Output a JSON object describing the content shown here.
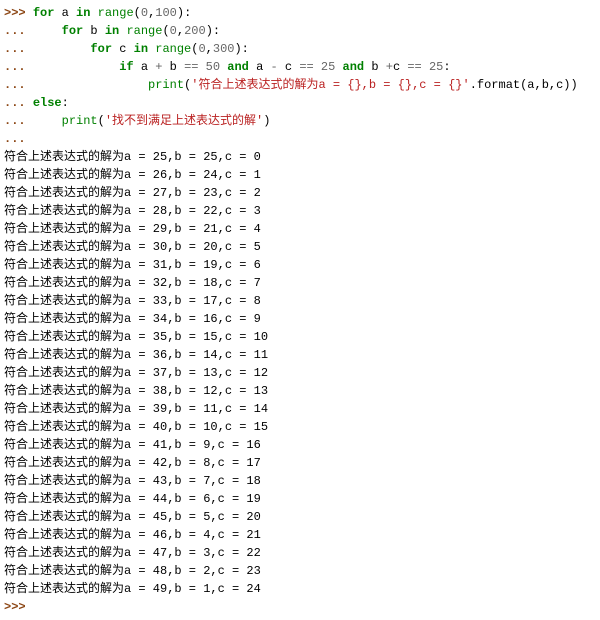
{
  "code": {
    "prompt_primary": ">>>",
    "prompt_cont": "...",
    "kw_for": "for",
    "kw_in": "in",
    "kw_if": "if",
    "kw_and": "and",
    "kw_else": "else",
    "builtin_range": "range",
    "builtin_print": "print",
    "var_a": "a",
    "var_b": "b",
    "var_c": "c",
    "num_0": "0",
    "num_100": "100",
    "num_200": "200",
    "num_300": "300",
    "num_50": "50",
    "num_25a": "25",
    "num_25b": "25",
    "str_match": "'符合上述表达式的解为a = {},b = {},c = {}'",
    "method_format": ".format(a,b,c))",
    "str_nomatch": "'找不到满足上述表达式的解'",
    "paren_close": ")"
  },
  "output_prefix": "符合上述表达式的解为",
  "rows": [
    {
      "a": 25,
      "b": 25,
      "c": 0
    },
    {
      "a": 26,
      "b": 24,
      "c": 1
    },
    {
      "a": 27,
      "b": 23,
      "c": 2
    },
    {
      "a": 28,
      "b": 22,
      "c": 3
    },
    {
      "a": 29,
      "b": 21,
      "c": 4
    },
    {
      "a": 30,
      "b": 20,
      "c": 5
    },
    {
      "a": 31,
      "b": 19,
      "c": 6
    },
    {
      "a": 32,
      "b": 18,
      "c": 7
    },
    {
      "a": 33,
      "b": 17,
      "c": 8
    },
    {
      "a": 34,
      "b": 16,
      "c": 9
    },
    {
      "a": 35,
      "b": 15,
      "c": 10
    },
    {
      "a": 36,
      "b": 14,
      "c": 11
    },
    {
      "a": 37,
      "b": 13,
      "c": 12
    },
    {
      "a": 38,
      "b": 12,
      "c": 13
    },
    {
      "a": 39,
      "b": 11,
      "c": 14
    },
    {
      "a": 40,
      "b": 10,
      "c": 15
    },
    {
      "a": 41,
      "b": 9,
      "c": 16
    },
    {
      "a": 42,
      "b": 8,
      "c": 17
    },
    {
      "a": 43,
      "b": 7,
      "c": 18
    },
    {
      "a": 44,
      "b": 6,
      "c": 19
    },
    {
      "a": 45,
      "b": 5,
      "c": 20
    },
    {
      "a": 46,
      "b": 4,
      "c": 21
    },
    {
      "a": 47,
      "b": 3,
      "c": 22
    },
    {
      "a": 48,
      "b": 2,
      "c": 23
    },
    {
      "a": 49,
      "b": 1,
      "c": 24
    }
  ]
}
